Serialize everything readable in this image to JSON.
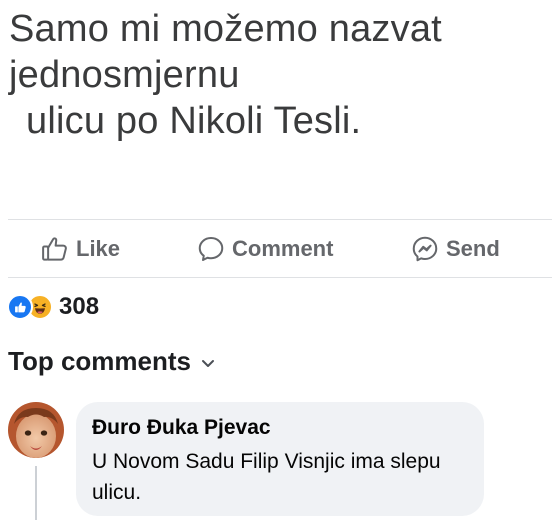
{
  "post": {
    "text_lines": [
      "Samo mi možemo nazvat",
      "jednosmjernu",
      "ulicu po Nikoli Tesli."
    ]
  },
  "actions": {
    "like_label": "Like",
    "comment_label": "Comment",
    "send_label": "Send"
  },
  "reactions": {
    "types": [
      "like",
      "haha"
    ],
    "count": "308"
  },
  "comments_section": {
    "sort_label": "Top comments",
    "sort_icon": "chevron-down-icon"
  },
  "comments": [
    {
      "author": "Đuro Đuka Pjevac",
      "text": "U Novom Sadu Filip Visnjic ima slepu ulicu."
    }
  ],
  "colors": {
    "like_blue": "#1877f2",
    "haha_yellow": "#f7b125",
    "action_gray": "#65676b",
    "bubble_bg": "#f0f2f5"
  }
}
